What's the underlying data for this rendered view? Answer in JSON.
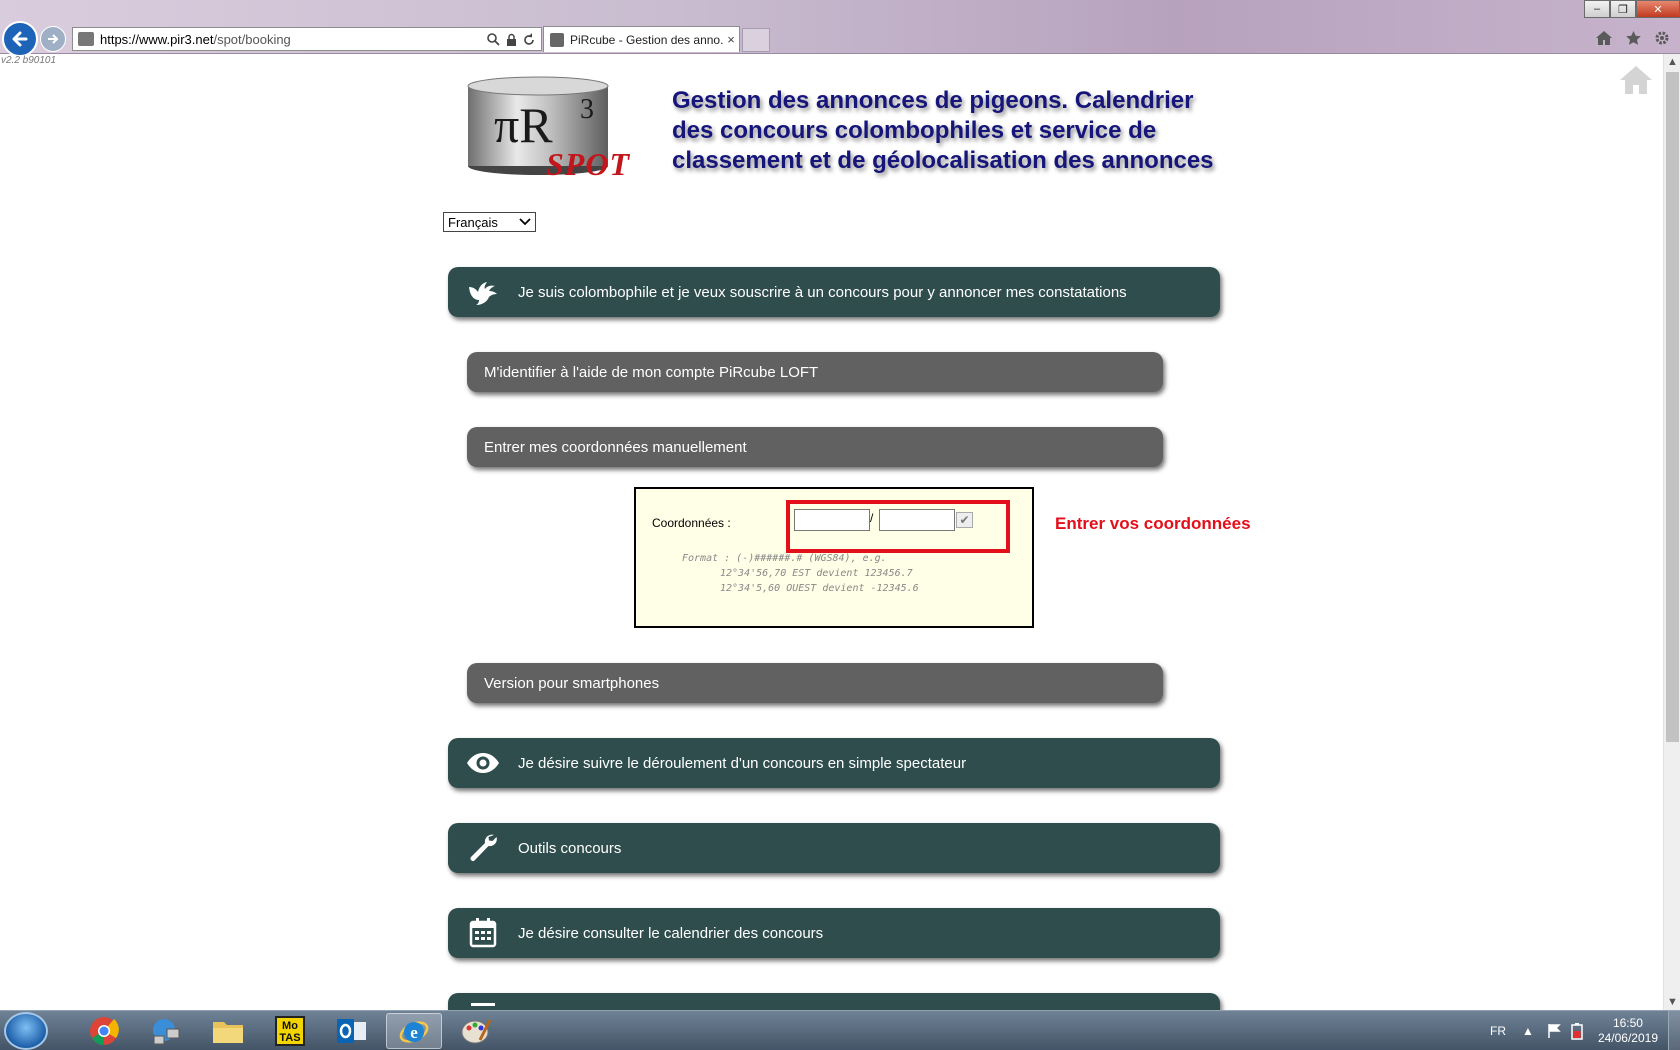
{
  "browser": {
    "url_domain": "https://www.pir3.net",
    "url_path": "/spot/booking",
    "tab_title": "PiRcube - Gestion des anno...",
    "tab_close": "×",
    "controls": {
      "minimize": "–",
      "maximize": "❐",
      "close": "✕"
    }
  },
  "version": "v2.2 b90101",
  "header": {
    "logo_main": "πR",
    "logo_sup": "3",
    "logo_spot": "SPOT",
    "title": "Gestion des annonces de pigeons. Calendrier des concours colombophiles et service de classement et de géolocalisation des annonces"
  },
  "language": {
    "selected": "Français"
  },
  "menu": {
    "fancier": "Je suis colombophile et je veux souscrire à un concours pour y annoncer mes constatations",
    "login_loft": "M'identifier à l'aide de mon compte PiRcube LOFT",
    "manual_coords": "Entrer mes coordonnées manuellement",
    "smartphone": "Version pour smartphones",
    "spectator": "Je désire suivre le déroulement d'un concours en simple spectateur",
    "tools": "Outils concours",
    "calendar": "Je désire consulter le calendrier des concours"
  },
  "coords": {
    "label": "Coordonnées :",
    "separator": "/",
    "lat_value": "",
    "lon_value": "",
    "format_line1": "Format : (-)######.# (WGS84), e.g.",
    "format_line2": "12°34'56,70 EST devient 123456.7",
    "format_line3": "12°34'5,60 OUEST devient -12345.6"
  },
  "annotation": "Entrer vos coordonnées",
  "taskbar": {
    "language": "FR",
    "time": "16:50",
    "date": "24/06/2019",
    "motas_line1": "Mo",
    "motas_line2": "TAS"
  },
  "colors": {
    "dark_bar": "#2e4d4c",
    "grey_bar": "#616161",
    "headline": "#16167a",
    "highlight": "#e30f1a"
  },
  "icons": [
    "back-arrow-icon",
    "forward-arrow-icon",
    "search-icon",
    "lock-icon",
    "refresh-icon",
    "home-icon",
    "star-icon",
    "gear-icon",
    "dove-icon",
    "eye-icon",
    "wrench-icon",
    "calendar-icon",
    "list-icon",
    "checkmark-icon",
    "windows-start-icon",
    "chrome-icon",
    "network-icon",
    "folder-icon",
    "outlook-icon",
    "ie-icon",
    "paint-icon",
    "flag-icon",
    "battery-icon"
  ]
}
